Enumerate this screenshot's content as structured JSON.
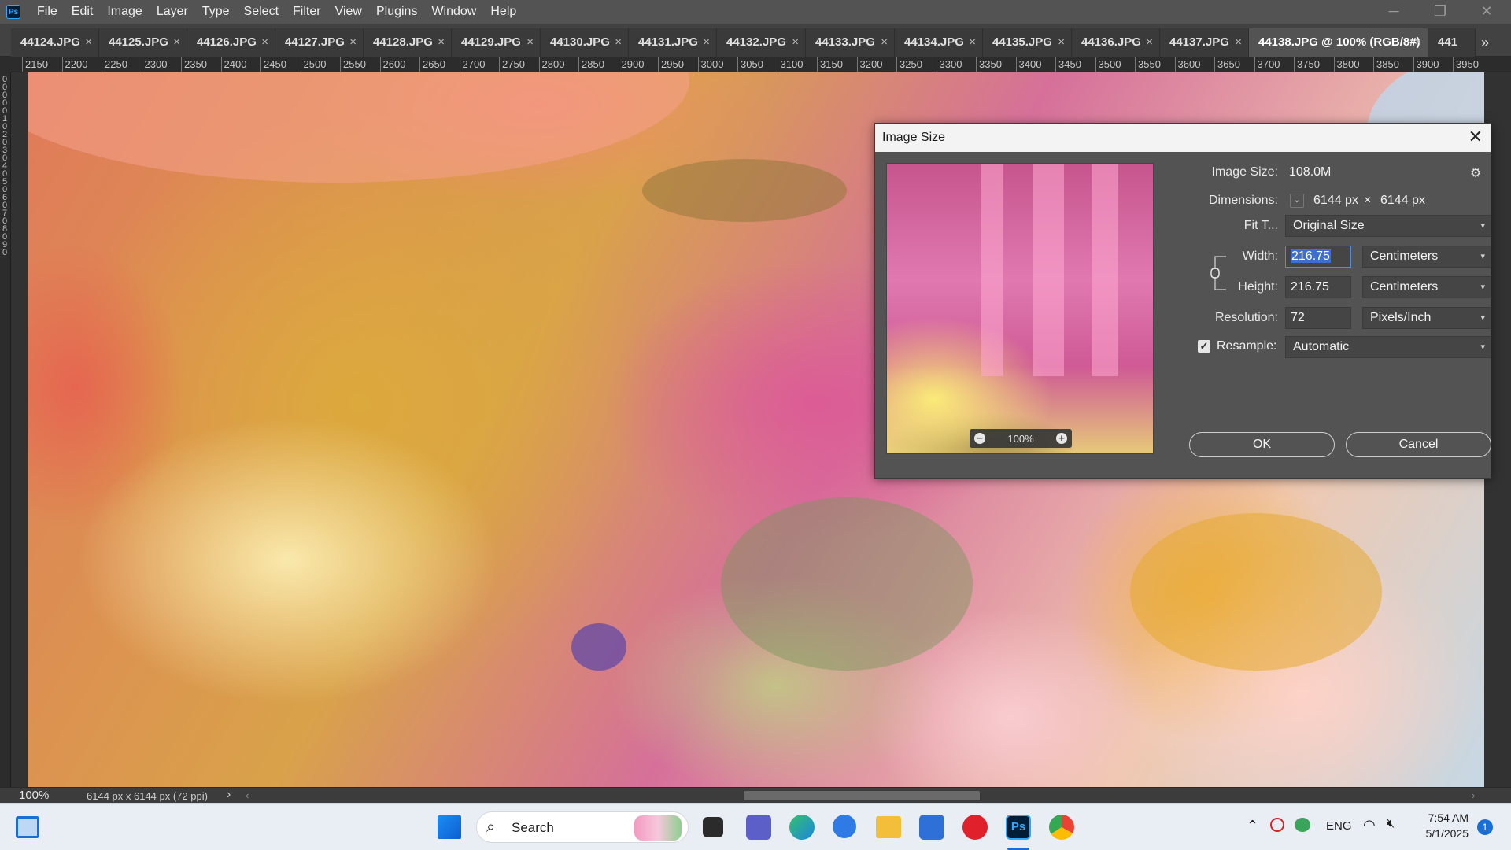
{
  "menu": {
    "app_icon": "Ps",
    "items": [
      "File",
      "Edit",
      "Image",
      "Layer",
      "Type",
      "Select",
      "Filter",
      "View",
      "Plugins",
      "Window",
      "Help"
    ],
    "window_controls": [
      "minimize-icon",
      "restore-icon",
      "close-icon"
    ]
  },
  "tabs": [
    {
      "label": "44124.JPG"
    },
    {
      "label": "44125.JPG"
    },
    {
      "label": "44126.JPG"
    },
    {
      "label": "44127.JPG"
    },
    {
      "label": "44128.JPG"
    },
    {
      "label": "44129.JPG"
    },
    {
      "label": "44130.JPG"
    },
    {
      "label": "44131.JPG"
    },
    {
      "label": "44132.JPG"
    },
    {
      "label": "44133.JPG"
    },
    {
      "label": "44134.JPG"
    },
    {
      "label": "44135.JPG"
    },
    {
      "label": "44136.JPG"
    },
    {
      "label": "44137.JPG"
    },
    {
      "label": "44138.JPG @ 100% (RGB/8#)",
      "active": true
    },
    {
      "label": "441"
    }
  ],
  "tab_close_glyph": "×",
  "tab_overflow_icon": "double-chevron-right-icon",
  "ruler": {
    "h_ticks": [
      "2150",
      "2200",
      "2250",
      "2300",
      "2350",
      "2400",
      "2450",
      "2500",
      "2550",
      "2600",
      "2650",
      "2700",
      "2750",
      "2800",
      "2850",
      "2900",
      "2950",
      "3000",
      "3050",
      "3100",
      "3150",
      "3200",
      "3250",
      "3300",
      "3350",
      "3400",
      "3450",
      "3500",
      "3550",
      "3600",
      "3650",
      "3700",
      "3750",
      "3800",
      "3850",
      "3900",
      "3950"
    ],
    "v_ticks": [
      "0",
      "0",
      "0",
      "0",
      "0",
      "1",
      "0",
      "2",
      "0",
      "3",
      "0",
      "4",
      "0",
      "5",
      "0",
      "6",
      "0",
      "7",
      "0",
      "8",
      "0",
      "9",
      "0"
    ]
  },
  "dialog": {
    "title": "Image Size",
    "close_glyph": "✕",
    "image_size_label": "Image Size:",
    "image_size_value": "108.0M",
    "settings_icon": "gear-icon",
    "dimensions_label": "Dimensions:",
    "dimensions_width": "6144 px",
    "dimensions_times": "×",
    "dimensions_height": "6144 px",
    "fit_to_label": "Fit T...",
    "fit_to_value": "Original Size",
    "width_label": "Width:",
    "width_value": "216.75",
    "width_unit": "Centimeters",
    "height_label": "Height:",
    "height_value": "216.75",
    "height_unit": "Centimeters",
    "resolution_label": "Resolution:",
    "resolution_value": "72",
    "resolution_unit": "Pixels/Inch",
    "resample_label": "Resample:",
    "resample_checked": true,
    "resample_value": "Automatic",
    "preview_zoom": "100%",
    "ok_label": "OK",
    "cancel_label": "Cancel"
  },
  "status": {
    "zoom": "100%",
    "doc_info": "6144 px x 6144 px (72 ppi)",
    "arrow": "›"
  },
  "taskbar": {
    "search_placeholder": "Search",
    "language": "ENG",
    "time": "7:54 AM",
    "date": "5/1/2025",
    "notification_count": "1"
  }
}
